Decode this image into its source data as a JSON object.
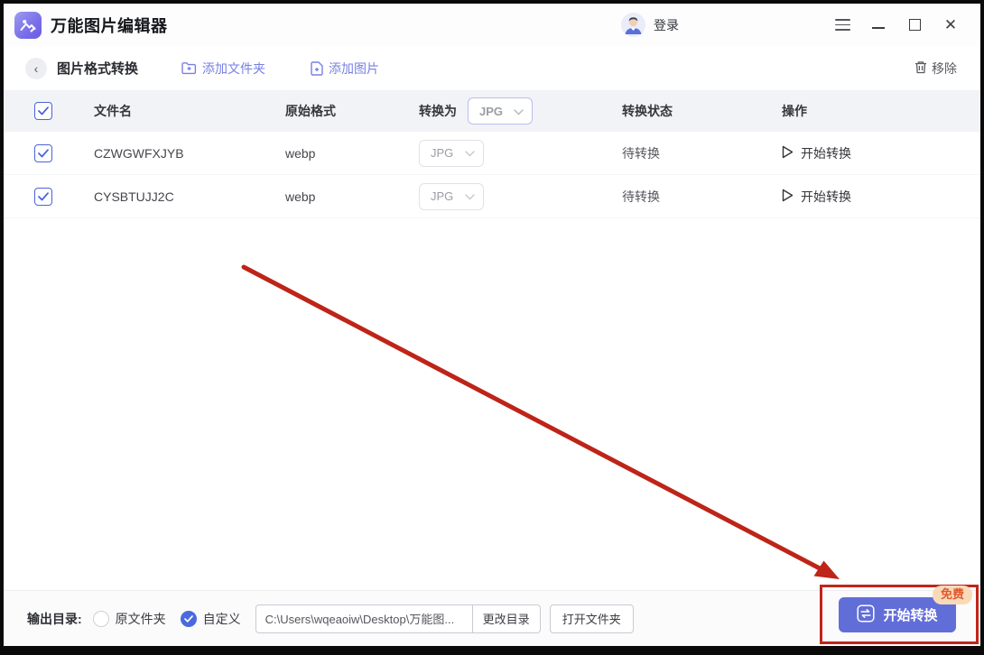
{
  "window": {
    "title": "万能图片编辑器",
    "login_label": "登录"
  },
  "icons": {
    "back": "‹",
    "close": "✕"
  },
  "toolbar": {
    "page_title": "图片格式转换",
    "add_folder": "添加文件夹",
    "add_image": "添加图片",
    "remove": "移除"
  },
  "table": {
    "headers": {
      "name": "文件名",
      "format": "原始格式",
      "convert_to": "转换为",
      "status": "转换状态",
      "operation": "操作"
    },
    "header_format_value": "JPG",
    "rows": [
      {
        "name": "CZWGWFXJYB",
        "format": "webp",
        "convert_to": "JPG",
        "status": "待转换",
        "action": "开始转换"
      },
      {
        "name": "CYSBTUJJ2C",
        "format": "webp",
        "convert_to": "JPG",
        "status": "待转换",
        "action": "开始转换"
      }
    ]
  },
  "footer": {
    "output_label": "输出目录:",
    "radio_original": "原文件夹",
    "radio_custom": "自定义",
    "path_value": "C:\\Users\\wqeaoiw\\Desktop\\万能图...",
    "change_dir": "更改目录",
    "open_folder": "打开文件夹",
    "start_convert": "开始转换",
    "free_badge": "免费"
  },
  "colors": {
    "accent": "#626ed8",
    "link": "#7780e3",
    "check_blue": "#4a64d9",
    "annotation_red": "#c1251b",
    "badge_bg": "#f8dab9",
    "badge_text": "#e2582f",
    "header_bg": "#f1f3f7"
  }
}
